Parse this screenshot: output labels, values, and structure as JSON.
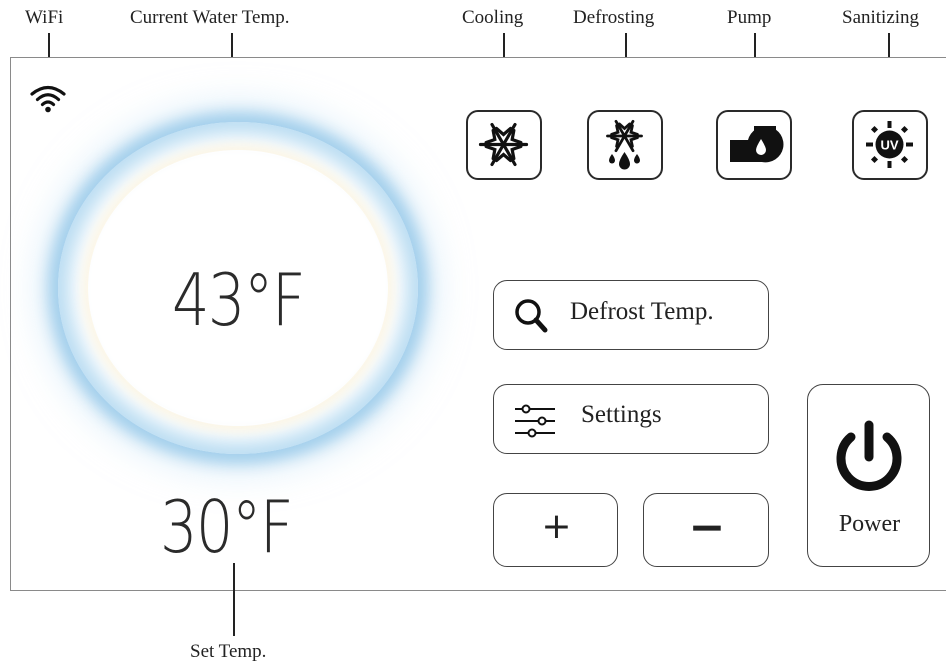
{
  "callouts": {
    "wifi": "WiFi",
    "current_water_temp": "Current Water Temp.",
    "cooling": "Cooling",
    "defrosting": "Defrosting",
    "pump": "Pump",
    "sanitizing": "Sanitizing",
    "set_temp": "Set Temp."
  },
  "display": {
    "current_temp": "43°F",
    "set_temp": "30°F"
  },
  "modes": [
    {
      "name": "cooling",
      "icon": "snowflake-icon"
    },
    {
      "name": "defrosting",
      "icon": "snowflake-drops-icon"
    },
    {
      "name": "pump",
      "icon": "pump-icon"
    },
    {
      "name": "sanitizing",
      "icon": "uv-icon",
      "icon_text": "UV"
    }
  ],
  "buttons": {
    "defrost_temp": "Defrost Temp.",
    "settings": "Settings",
    "plus": "+",
    "minus": "−",
    "power": "Power"
  },
  "colors": {
    "ring_glow": "#a0cdeb",
    "outline": "#2a2a2a",
    "panel_border": "#8a8a8a"
  }
}
